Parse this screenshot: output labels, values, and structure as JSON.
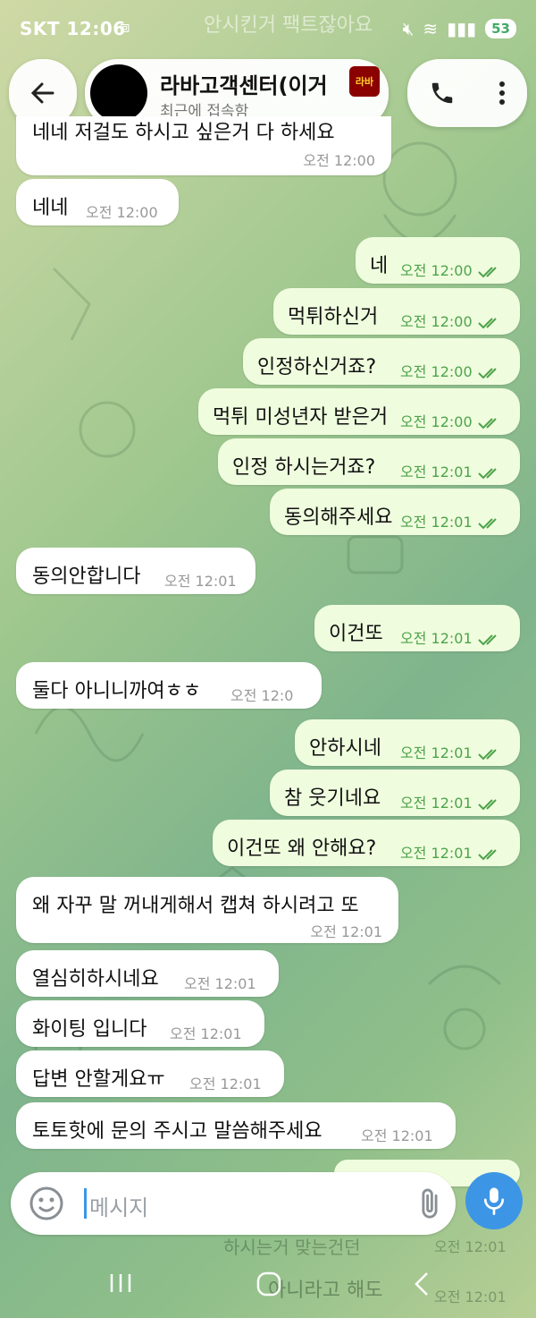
{
  "status": {
    "carrier_time": "SKT 12:06",
    "battery": "53"
  },
  "header": {
    "title": "라바고객센터(이거",
    "subtitle": "최근에 접속함",
    "logo_text": "라바"
  },
  "notification_ghost": "안시킨거 팩트잖아요",
  "messages": [
    {
      "dir": "in",
      "text": "네네 저걸도 하시고 싶은거 다 하세요",
      "time": "오전 12:00"
    },
    {
      "dir": "in",
      "text": "네네",
      "time": "오전 12:00"
    },
    {
      "dir": "out",
      "text": "네",
      "time": "오전 12:00"
    },
    {
      "dir": "out",
      "text": "먹튀하신거",
      "time": "오전 12:00"
    },
    {
      "dir": "out",
      "text": "인정하신거죠?",
      "time": "오전 12:00"
    },
    {
      "dir": "out",
      "text": "먹튀 미성년자 받은거",
      "time": "오전 12:00"
    },
    {
      "dir": "out",
      "text": "인정 하시는거죠?",
      "time": "오전 12:01"
    },
    {
      "dir": "out",
      "text": "동의해주세요",
      "time": "오전 12:01"
    },
    {
      "dir": "in",
      "text": "동의안합니다",
      "time": "오전 12:01"
    },
    {
      "dir": "out",
      "text": "이건또",
      "time": "오전 12:01"
    },
    {
      "dir": "in",
      "text": "둘다 아니니까여ㅎㅎ",
      "time": "오전 12:0"
    },
    {
      "dir": "out",
      "text": "안하시네",
      "time": "오전 12:01"
    },
    {
      "dir": "out",
      "text": "참 웃기네요",
      "time": "오전 12:01"
    },
    {
      "dir": "out",
      "text": "이건또 왜 안해요?",
      "time": "오전 12:01"
    },
    {
      "dir": "in",
      "text": "왜 자꾸 말 꺼내게해서 캡쳐 하시려고 또",
      "time": "오전 12:01"
    },
    {
      "dir": "in",
      "text": "열심히하시네요",
      "time": "오전 12:01"
    },
    {
      "dir": "in",
      "text": "화이팅 입니다",
      "time": "오전 12:01"
    },
    {
      "dir": "in",
      "text": "답변 안할게요ㅠ",
      "time": "오전 12:01"
    },
    {
      "dir": "in",
      "text": "토토핫에 문의 주시고 말씀해주세요",
      "time": "오전 12:01"
    }
  ],
  "composer": {
    "placeholder": "메시지"
  },
  "ghost_bottom": {
    "line1": "하시는거 맞는건던",
    "line2": "아니라고 해도",
    "time1": "오전 12:01",
    "time2": "오전 12:01"
  }
}
